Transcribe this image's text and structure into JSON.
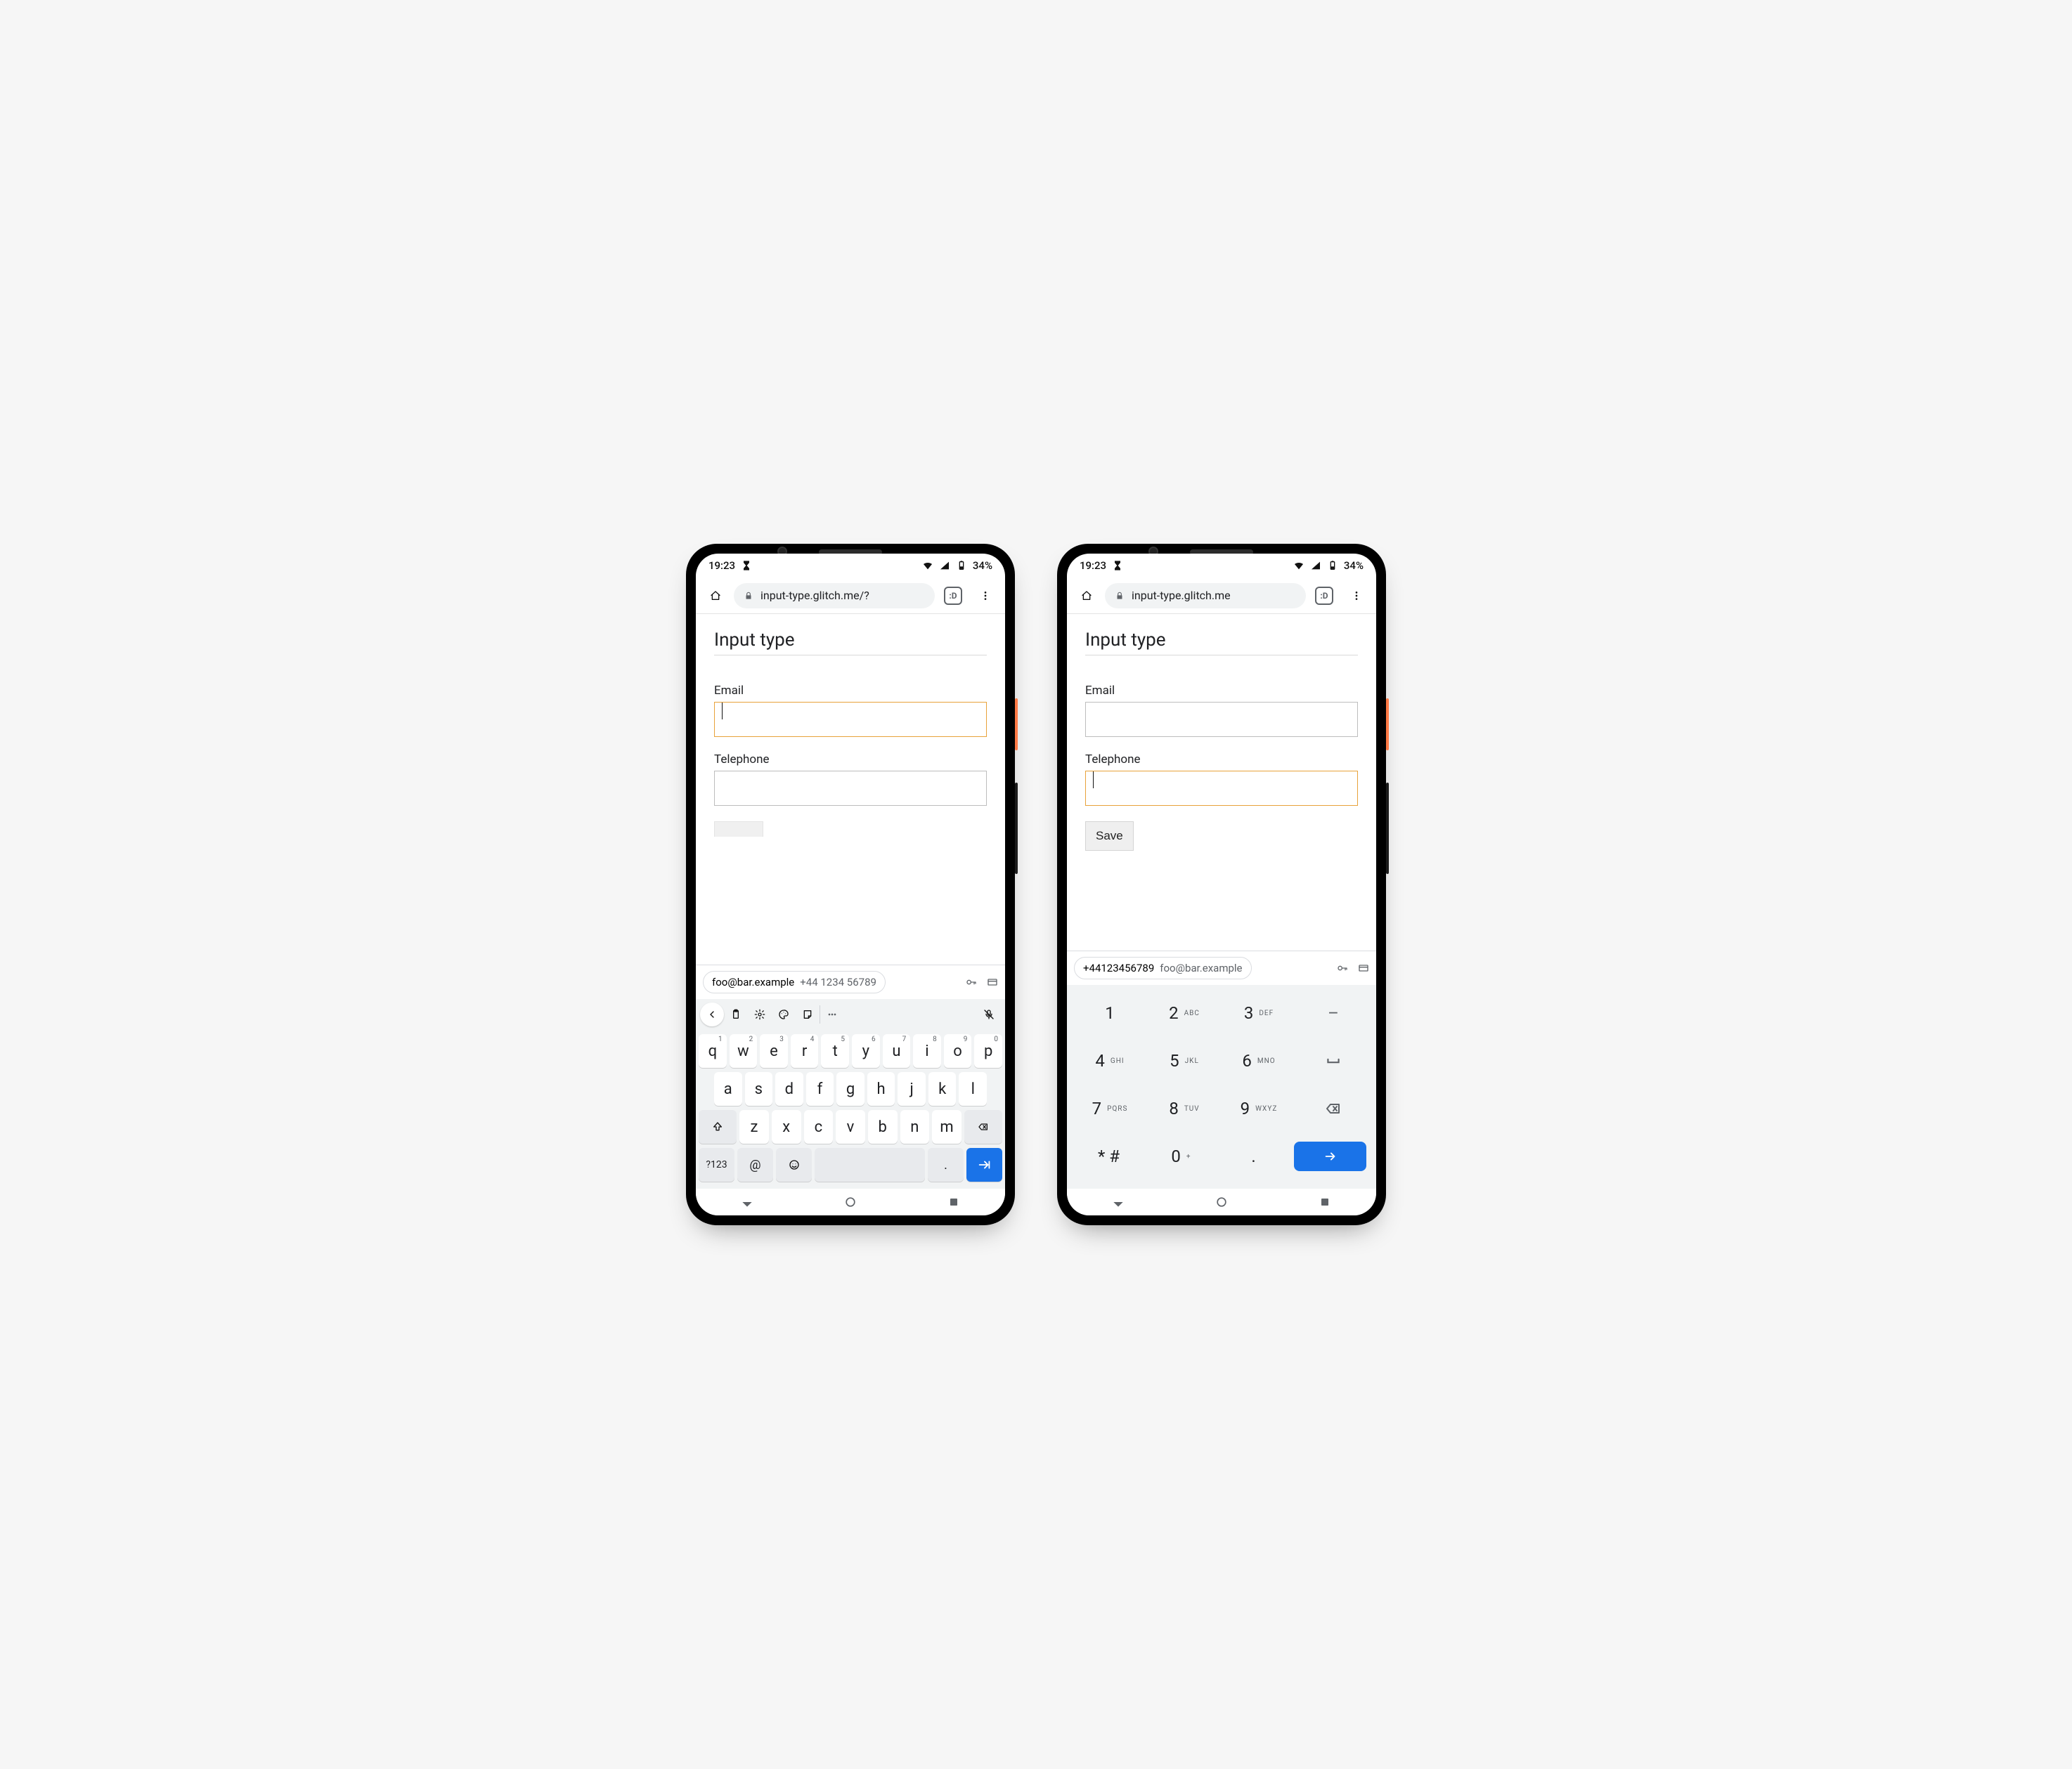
{
  "status": {
    "time": "19:23",
    "battery": "34%"
  },
  "chrome": {
    "url_left": "input-type.glitch.me/?",
    "url_right": "input-type.glitch.me",
    "tab_badge": ":D"
  },
  "page": {
    "heading": "Input type",
    "email_label": "Email",
    "telephone_label": "Telephone",
    "save_label": "Save"
  },
  "autofill": {
    "email": "foo@bar.example",
    "phone": "+44 1234 56789",
    "phone_compact": "+44123456789"
  },
  "qwerty": {
    "row1": [
      [
        "q",
        "1"
      ],
      [
        "w",
        "2"
      ],
      [
        "e",
        "3"
      ],
      [
        "r",
        "4"
      ],
      [
        "t",
        "5"
      ],
      [
        "y",
        "6"
      ],
      [
        "u",
        "7"
      ],
      [
        "i",
        "8"
      ],
      [
        "o",
        "9"
      ],
      [
        "p",
        "0"
      ]
    ],
    "row2": [
      "a",
      "s",
      "d",
      "f",
      "g",
      "h",
      "j",
      "k",
      "l"
    ],
    "row3": [
      "z",
      "x",
      "c",
      "v",
      "b",
      "n",
      "m"
    ],
    "sym": "?123",
    "at": "@",
    "dot": "."
  },
  "dialpad": {
    "rows": [
      [
        [
          "1",
          ""
        ],
        [
          "2",
          "ABC"
        ],
        [
          "3",
          "DEF"
        ],
        [
          "-",
          ""
        ]
      ],
      [
        [
          "4",
          "GHI"
        ],
        [
          "5",
          "JKL"
        ],
        [
          "6",
          "MNO"
        ],
        [
          "␣",
          ""
        ]
      ],
      [
        [
          "7",
          "PQRS"
        ],
        [
          "8",
          "TUV"
        ],
        [
          "9",
          "WXYZ"
        ],
        [
          "⌫",
          ""
        ]
      ],
      [
        [
          "* #",
          ""
        ],
        [
          "0",
          "+"
        ],
        [
          ".",
          ""
        ],
        [
          "→",
          ""
        ]
      ]
    ]
  }
}
